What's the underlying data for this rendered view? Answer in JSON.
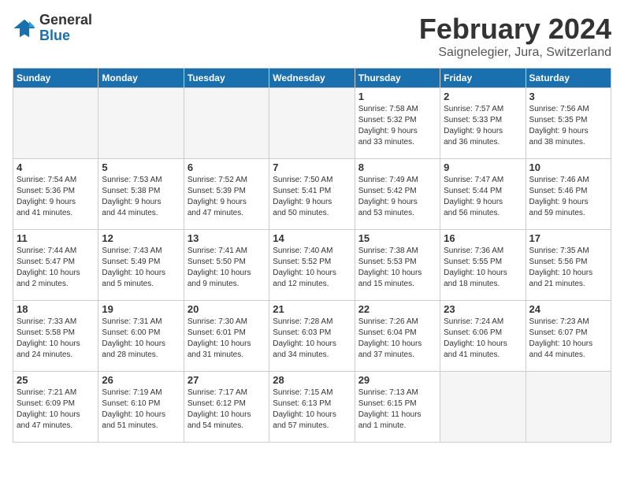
{
  "header": {
    "logo_general": "General",
    "logo_blue": "Blue",
    "month_title": "February 2024",
    "location": "Saignelegier, Jura, Switzerland"
  },
  "weekdays": [
    "Sunday",
    "Monday",
    "Tuesday",
    "Wednesday",
    "Thursday",
    "Friday",
    "Saturday"
  ],
  "weeks": [
    [
      {
        "day": "",
        "info": ""
      },
      {
        "day": "",
        "info": ""
      },
      {
        "day": "",
        "info": ""
      },
      {
        "day": "",
        "info": ""
      },
      {
        "day": "1",
        "info": "Sunrise: 7:58 AM\nSunset: 5:32 PM\nDaylight: 9 hours\nand 33 minutes."
      },
      {
        "day": "2",
        "info": "Sunrise: 7:57 AM\nSunset: 5:33 PM\nDaylight: 9 hours\nand 36 minutes."
      },
      {
        "day": "3",
        "info": "Sunrise: 7:56 AM\nSunset: 5:35 PM\nDaylight: 9 hours\nand 38 minutes."
      }
    ],
    [
      {
        "day": "4",
        "info": "Sunrise: 7:54 AM\nSunset: 5:36 PM\nDaylight: 9 hours\nand 41 minutes."
      },
      {
        "day": "5",
        "info": "Sunrise: 7:53 AM\nSunset: 5:38 PM\nDaylight: 9 hours\nand 44 minutes."
      },
      {
        "day": "6",
        "info": "Sunrise: 7:52 AM\nSunset: 5:39 PM\nDaylight: 9 hours\nand 47 minutes."
      },
      {
        "day": "7",
        "info": "Sunrise: 7:50 AM\nSunset: 5:41 PM\nDaylight: 9 hours\nand 50 minutes."
      },
      {
        "day": "8",
        "info": "Sunrise: 7:49 AM\nSunset: 5:42 PM\nDaylight: 9 hours\nand 53 minutes."
      },
      {
        "day": "9",
        "info": "Sunrise: 7:47 AM\nSunset: 5:44 PM\nDaylight: 9 hours\nand 56 minutes."
      },
      {
        "day": "10",
        "info": "Sunrise: 7:46 AM\nSunset: 5:46 PM\nDaylight: 9 hours\nand 59 minutes."
      }
    ],
    [
      {
        "day": "11",
        "info": "Sunrise: 7:44 AM\nSunset: 5:47 PM\nDaylight: 10 hours\nand 2 minutes."
      },
      {
        "day": "12",
        "info": "Sunrise: 7:43 AM\nSunset: 5:49 PM\nDaylight: 10 hours\nand 5 minutes."
      },
      {
        "day": "13",
        "info": "Sunrise: 7:41 AM\nSunset: 5:50 PM\nDaylight: 10 hours\nand 9 minutes."
      },
      {
        "day": "14",
        "info": "Sunrise: 7:40 AM\nSunset: 5:52 PM\nDaylight: 10 hours\nand 12 minutes."
      },
      {
        "day": "15",
        "info": "Sunrise: 7:38 AM\nSunset: 5:53 PM\nDaylight: 10 hours\nand 15 minutes."
      },
      {
        "day": "16",
        "info": "Sunrise: 7:36 AM\nSunset: 5:55 PM\nDaylight: 10 hours\nand 18 minutes."
      },
      {
        "day": "17",
        "info": "Sunrise: 7:35 AM\nSunset: 5:56 PM\nDaylight: 10 hours\nand 21 minutes."
      }
    ],
    [
      {
        "day": "18",
        "info": "Sunrise: 7:33 AM\nSunset: 5:58 PM\nDaylight: 10 hours\nand 24 minutes."
      },
      {
        "day": "19",
        "info": "Sunrise: 7:31 AM\nSunset: 6:00 PM\nDaylight: 10 hours\nand 28 minutes."
      },
      {
        "day": "20",
        "info": "Sunrise: 7:30 AM\nSunset: 6:01 PM\nDaylight: 10 hours\nand 31 minutes."
      },
      {
        "day": "21",
        "info": "Sunrise: 7:28 AM\nSunset: 6:03 PM\nDaylight: 10 hours\nand 34 minutes."
      },
      {
        "day": "22",
        "info": "Sunrise: 7:26 AM\nSunset: 6:04 PM\nDaylight: 10 hours\nand 37 minutes."
      },
      {
        "day": "23",
        "info": "Sunrise: 7:24 AM\nSunset: 6:06 PM\nDaylight: 10 hours\nand 41 minutes."
      },
      {
        "day": "24",
        "info": "Sunrise: 7:23 AM\nSunset: 6:07 PM\nDaylight: 10 hours\nand 44 minutes."
      }
    ],
    [
      {
        "day": "25",
        "info": "Sunrise: 7:21 AM\nSunset: 6:09 PM\nDaylight: 10 hours\nand 47 minutes."
      },
      {
        "day": "26",
        "info": "Sunrise: 7:19 AM\nSunset: 6:10 PM\nDaylight: 10 hours\nand 51 minutes."
      },
      {
        "day": "27",
        "info": "Sunrise: 7:17 AM\nSunset: 6:12 PM\nDaylight: 10 hours\nand 54 minutes."
      },
      {
        "day": "28",
        "info": "Sunrise: 7:15 AM\nSunset: 6:13 PM\nDaylight: 10 hours\nand 57 minutes."
      },
      {
        "day": "29",
        "info": "Sunrise: 7:13 AM\nSunset: 6:15 PM\nDaylight: 11 hours\nand 1 minute."
      },
      {
        "day": "",
        "info": ""
      },
      {
        "day": "",
        "info": ""
      }
    ]
  ]
}
